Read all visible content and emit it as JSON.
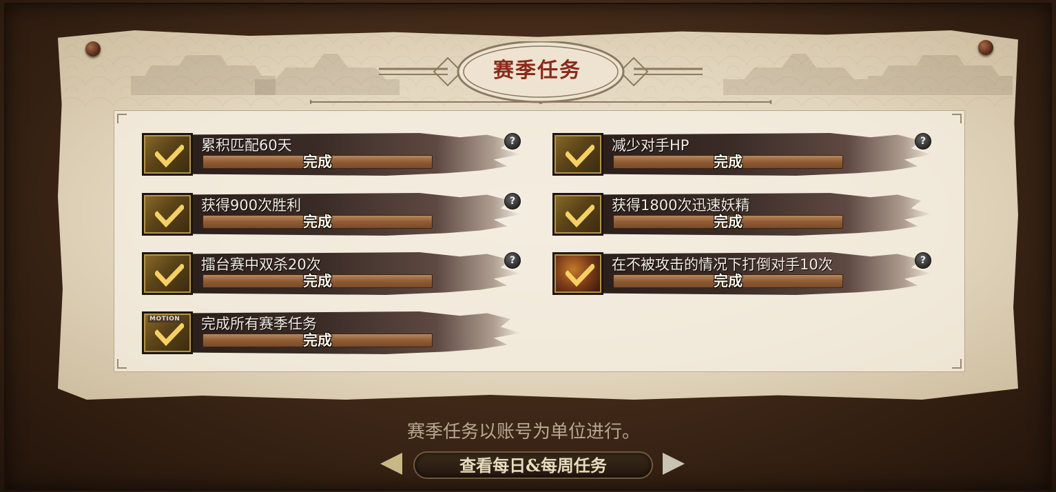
{
  "panel": {
    "title": "赛季任务"
  },
  "tasks": [
    {
      "name": "累积匹配60天",
      "status": "完成",
      "help": "?",
      "icon": "check-icon"
    },
    {
      "name": "减少对手HP",
      "status": "完成",
      "help": "?",
      "icon": "check-icon"
    },
    {
      "name": "获得900次胜利",
      "status": "完成",
      "help": "?",
      "icon": "check-icon"
    },
    {
      "name": "获得1800次迅速妖精",
      "status": "完成",
      "help": "",
      "icon": "check-icon"
    },
    {
      "name": "擂台赛中双杀20次",
      "status": "完成",
      "help": "?",
      "icon": "check-icon"
    },
    {
      "name": "在不被攻击的情况下打倒对手10次",
      "status": "完成",
      "help": "?",
      "icon": "check-icon"
    },
    {
      "name": "完成所有赛季任务",
      "status": "完成",
      "help": "",
      "icon": "check-icon",
      "badge": "MOTION"
    }
  ],
  "footer": {
    "note": "赛季任务以账号为单位进行。",
    "nav_label": "查看每日&每周任务"
  },
  "colors": {
    "title": "#8a2a1a",
    "bar": "#8e5c36",
    "frame": "#3d2616"
  }
}
